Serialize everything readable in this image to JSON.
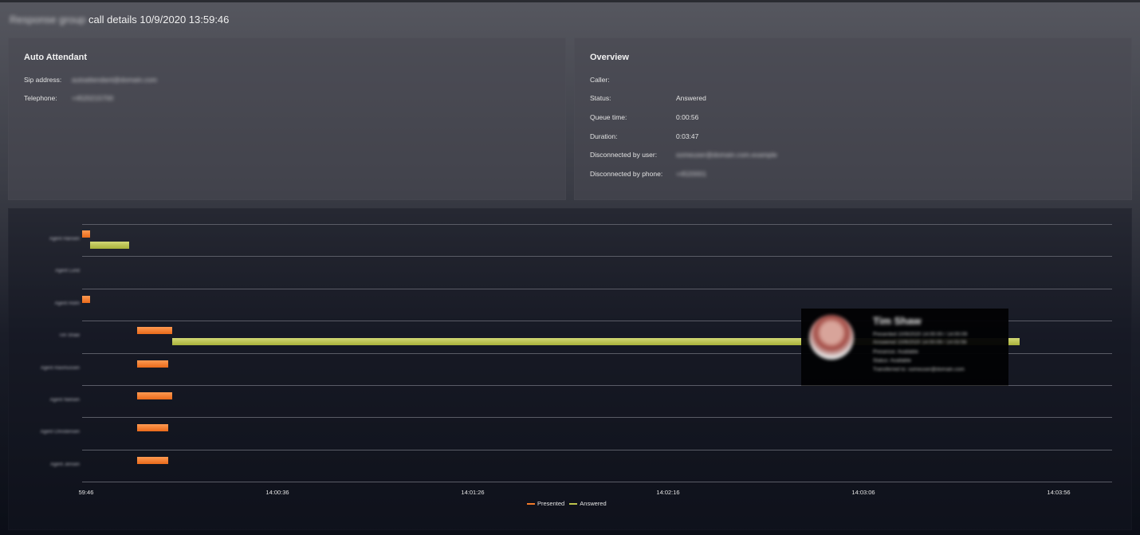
{
  "header": {
    "group_name_blurred": "Response group",
    "title": "call details 10/9/2020 13:59:46"
  },
  "auto_attendant": {
    "heading": "Auto Attendant",
    "fields": [
      {
        "label": "Sip address:",
        "value": "autoattendant@domain.com"
      },
      {
        "label": "Telephone:",
        "value": "+4520215700"
      }
    ]
  },
  "overview": {
    "heading": "Overview",
    "fields": [
      {
        "label": "Caller:",
        "value": ""
      },
      {
        "label": "Status:",
        "value": "Answered"
      },
      {
        "label": "Queue time:",
        "value": "0:00:56"
      },
      {
        "label": "Duration:",
        "value": "0:03:47"
      },
      {
        "label": "Disconnected by user:",
        "value": "someuser@domain.com.example"
      },
      {
        "label": "Disconnected by phone:",
        "value": "+4520001"
      }
    ]
  },
  "colors": {
    "presented": "#f27a2a",
    "answered": "#bcc24c"
  },
  "chart_data": {
    "type": "gantt",
    "start_time": "13:59:46",
    "x_ticks": [
      "59:46",
      "14:00:36",
      "14:01:26",
      "14:02:16",
      "14:03:06",
      "14:03:56"
    ],
    "rows": [
      {
        "label": "Agent Hansen",
        "presented": [
          [
            0,
            2
          ]
        ],
        "answered": [
          [
            2,
            12
          ]
        ]
      },
      {
        "label": "Agent Lund",
        "presented": [],
        "answered": []
      },
      {
        "label": "Agent Holm",
        "presented": [
          [
            0,
            2
          ]
        ],
        "answered": []
      },
      {
        "label": "Tim Shaw",
        "presented": [
          [
            14,
            23
          ]
        ],
        "answered": [
          [
            23,
            240
          ]
        ]
      },
      {
        "label": "Agent Rasmussen",
        "presented": [
          [
            14,
            22
          ]
        ],
        "answered": []
      },
      {
        "label": "Agent Nielsen",
        "presented": [
          [
            14,
            23
          ]
        ],
        "answered": []
      },
      {
        "label": "Agent Christensen",
        "presented": [
          [
            14,
            22
          ]
        ],
        "answered": []
      },
      {
        "label": "Agent Jensen",
        "presented": [
          [
            14,
            22
          ]
        ],
        "answered": []
      }
    ],
    "legend": [
      "Presented",
      "Answered"
    ]
  },
  "tooltip": {
    "name": "Tim Shaw",
    "lines": [
      "Presented 10/9/2020 14:00:00 / 14:00:09",
      "Answered 10/9/2020 14:00:09 / 14:03:56",
      "Presence: Available",
      "Status: Available",
      "Transferred to: someuser@domain.com"
    ]
  }
}
